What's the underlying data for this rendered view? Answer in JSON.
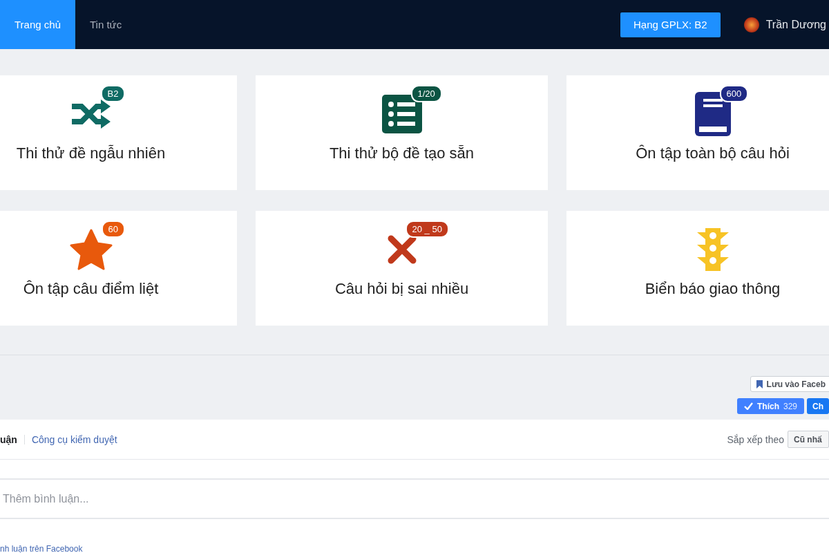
{
  "nav": {
    "tabs": [
      {
        "label": "Trang chủ",
        "selected": true
      },
      {
        "label": "Tin tức",
        "selected": false
      }
    ],
    "license_button": "Hạng GPLX: B2",
    "user_name": "Trần Dương"
  },
  "cards": [
    {
      "kind": "shuffle",
      "badge": "B2",
      "title": "Thi thử đề ngẫu nhiên",
      "color": "#0f6b64"
    },
    {
      "kind": "list",
      "badge": "1/20",
      "title": "Thi thử bộ đề tạo sẵn",
      "color": "#0b5443"
    },
    {
      "kind": "book",
      "badge": "600",
      "title": "Ôn tập toàn bộ câu hỏi",
      "color": "#1f2a85"
    },
    {
      "kind": "star",
      "badge": "60",
      "title": "Ôn tập câu điểm liệt",
      "color": "#e8590c"
    },
    {
      "kind": "cross",
      "badge": "20 _ 50",
      "title": "Câu hỏi bị sai nhiều",
      "color": "#c0391b"
    },
    {
      "kind": "traffic",
      "title": "Biển báo giao thông",
      "color": "#f7c325"
    }
  ],
  "facebook": {
    "save_button": "Lưu vào Faceb",
    "like_button": "Thích",
    "like_count": "329",
    "share_button": "Ch",
    "comments": {
      "tab": "uận",
      "moderation_link": "Công cụ kiểm duyệt",
      "sort_label": "Sắp xếp theo",
      "sort_value": "Cũ nhấ",
      "input_placeholder": "Thêm bình luận...",
      "footer_link": "nh luận trên Facebook"
    }
  }
}
